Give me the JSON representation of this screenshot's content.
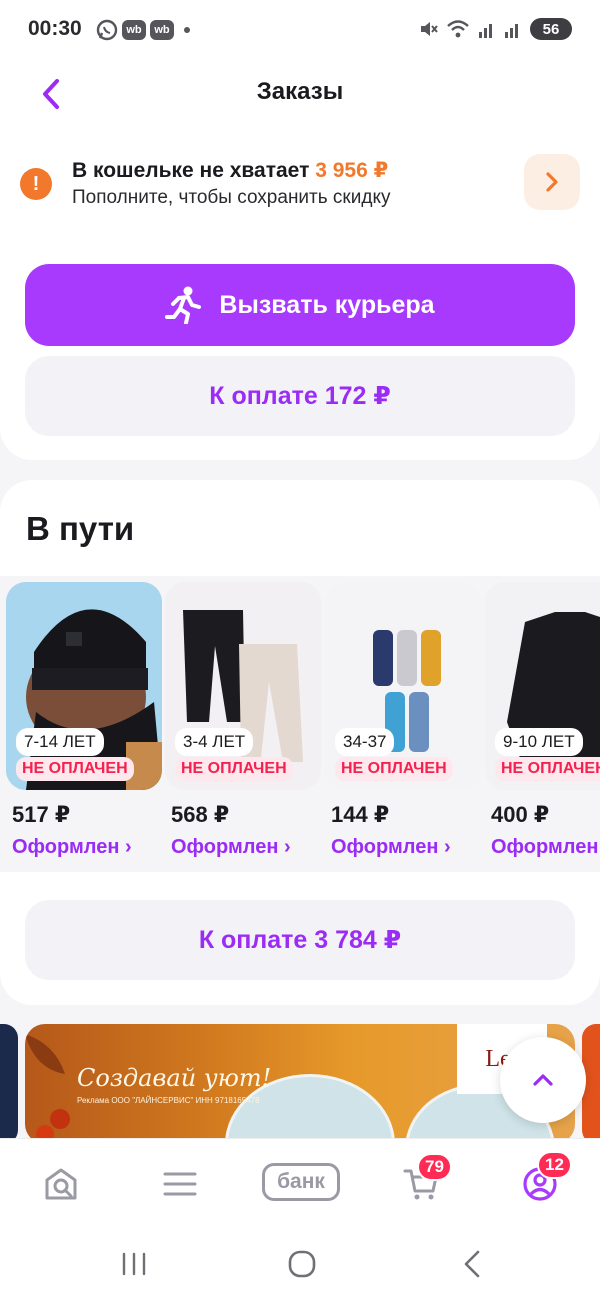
{
  "status_bar": {
    "time": "00:30",
    "badge1": "wb",
    "badge2": "wb",
    "battery": "56"
  },
  "header": {
    "title": "Заказы"
  },
  "wallet": {
    "title": "В кошельке не хватает ",
    "amount": "3 956 ₽",
    "subtitle": "Пополните, чтобы сохранить скидку"
  },
  "courier_button": "Вызвать курьера",
  "pay_button_1": "К оплате 172 ₽",
  "transit": {
    "title": "В пути",
    "products": [
      {
        "size": "7-14 ЛЕТ",
        "status": "НЕ ОПЛАЧЕН",
        "price": "517 ₽",
        "state": "Оформлен ›"
      },
      {
        "size": "3-4 ЛЕТ",
        "status": "НЕ ОПЛАЧЕН",
        "price": "568 ₽",
        "state": "Оформлен ›"
      },
      {
        "size": "34-37",
        "status": "НЕ ОПЛАЧЕН",
        "price": "144 ₽",
        "state": "Оформлен ›"
      },
      {
        "size": "9-10 ЛЕТ",
        "status": "НЕ ОПЛАЧЕН",
        "price": "400 ₽",
        "state": "Оформлен ›"
      }
    ],
    "pay_button": "К оплате 3 784 ₽"
  },
  "banner": {
    "text": "Создавай уют!",
    "ad_line": "Реклама ООО \"ЛАЙНСЕРВИС\" ИНН 9718165478",
    "brand": "Lef"
  },
  "tabbar": {
    "bank_label": "банк",
    "cart_count": "79",
    "profile_count": "12",
    "accent": "#a73afd"
  }
}
